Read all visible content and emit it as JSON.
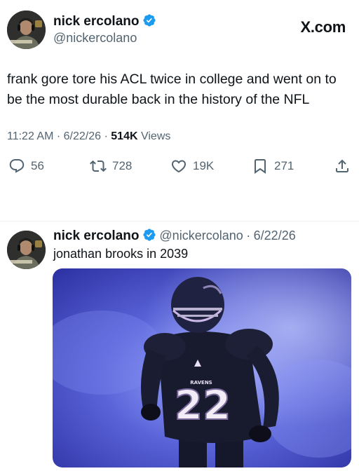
{
  "tweet": {
    "author": {
      "name": "nick ercolano",
      "handle": "@nickercolano",
      "verified_color": "#1d9bf0"
    },
    "brand": "X.com",
    "text": "frank gore tore his ACL twice in college and went on to be the most durable back in the history of the NFL",
    "time": "11:22 AM",
    "date": "6/22/26",
    "views_count": "514K",
    "views_label": "Views",
    "separator": "·",
    "actions": {
      "replies": "56",
      "reposts": "728",
      "likes": "19K",
      "bookmarks": "271"
    }
  },
  "reply": {
    "author": {
      "name": "nick ercolano",
      "handle": "@nickercolano",
      "date": "6/22/26"
    },
    "separator": "·",
    "text": "jonathan brooks in 2039",
    "media": {
      "jersey_number": "22",
      "team_wordmark": "RAVENS"
    }
  },
  "icons": {
    "reply": "reply-icon",
    "repost": "repost-icon",
    "like": "heart-icon",
    "bookmark": "bookmark-icon",
    "share": "share-icon",
    "verified": "verified-badge-icon"
  },
  "colors": {
    "text_primary": "#0f1419",
    "text_secondary": "#536471",
    "verified": "#1d9bf0",
    "divider": "#eff3f4"
  }
}
